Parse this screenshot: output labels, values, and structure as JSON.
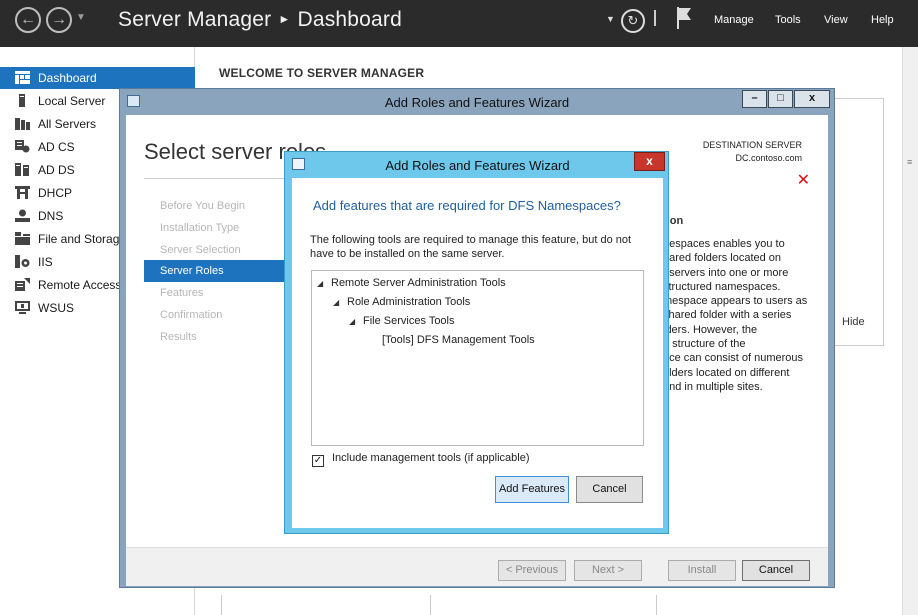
{
  "app": {
    "title": "Server Manager",
    "page": "Dashboard",
    "menus": [
      "Manage",
      "Tools",
      "View",
      "Help"
    ]
  },
  "sidebar": {
    "items": [
      {
        "label": "Dashboard",
        "icon": "dashboard-icon",
        "active": true
      },
      {
        "label": "Local Server",
        "icon": "local-server-icon"
      },
      {
        "label": "All Servers",
        "icon": "all-servers-icon"
      },
      {
        "label": "AD CS",
        "icon": "ad-cs-icon"
      },
      {
        "label": "AD DS",
        "icon": "ad-ds-icon"
      },
      {
        "label": "DHCP",
        "icon": "dhcp-icon"
      },
      {
        "label": "DNS",
        "icon": "dns-icon"
      },
      {
        "label": "File and Storag",
        "icon": "file-storage-icon"
      },
      {
        "label": "IIS",
        "icon": "iis-icon"
      },
      {
        "label": "Remote Access",
        "icon": "remote-access-icon"
      },
      {
        "label": "WSUS",
        "icon": "wsus-icon"
      }
    ]
  },
  "main": {
    "welcome": "WELCOME TO SERVER MANAGER",
    "hide": "Hide"
  },
  "wizard": {
    "title": "Add Roles and Features Wizard",
    "heading": "Select server roles",
    "destination_label": "DESTINATION SERVER",
    "destination_value": "DC.contoso.com",
    "steps": [
      "Before You Begin",
      "Installation Type",
      "Server Selection",
      "Server Roles",
      "Features",
      "Confirmation",
      "Results"
    ],
    "current_step": "Server Roles",
    "description_title": "tion",
    "description_lines": [
      "nespaces enables you to",
      "hared folders located on",
      "t servers into one or more",
      "structured namespaces.",
      "mespace appears to users as",
      "shared folder with a series",
      "lders. However, the",
      "g structure of the",
      "ace can consist of numerous",
      "olders located on different",
      "and in multiple sites."
    ],
    "buttons": {
      "previous": "< Previous",
      "next": "Next >",
      "install": "Install",
      "cancel": "Cancel"
    }
  },
  "dialog": {
    "title": "Add Roles and Features Wizard",
    "heading": "Add features that are required for DFS Namespaces?",
    "info": "The following tools are required to manage this feature, but do not have to be installed on the same server.",
    "tree": [
      {
        "label": "Remote Server Administration Tools",
        "level": 0,
        "expanded": true
      },
      {
        "label": "Role Administration Tools",
        "level": 1,
        "expanded": true
      },
      {
        "label": "File Services Tools",
        "level": 2,
        "expanded": true
      },
      {
        "label": "[Tools] DFS Management Tools",
        "level": 3,
        "expanded": false
      }
    ],
    "include_label": "Include management tools (if applicable)",
    "include_checked": true,
    "buttons": {
      "add": "Add Features",
      "cancel": "Cancel"
    }
  },
  "colors": {
    "accent": "#1e73be",
    "titlebar": "#2b2b2b",
    "dialog_frame": "#6ec8ec",
    "close_red": "#c6362b"
  }
}
